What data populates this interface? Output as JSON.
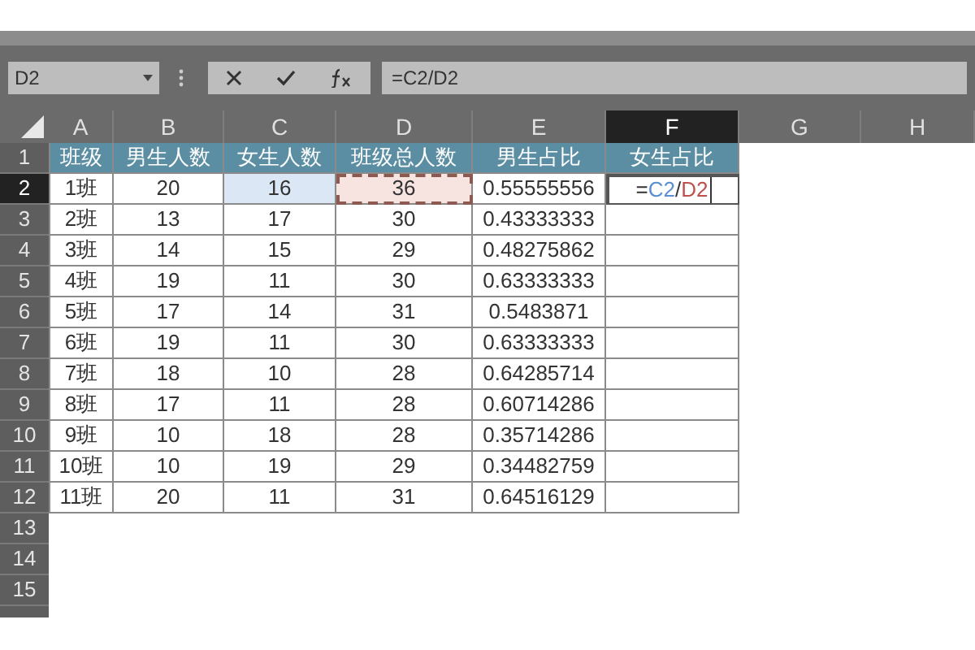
{
  "formula_bar": {
    "name_box": "D2",
    "formula": "=C2/D2"
  },
  "columns": [
    {
      "label": "A",
      "selected": false
    },
    {
      "label": "B",
      "selected": false
    },
    {
      "label": "C",
      "selected": false
    },
    {
      "label": "D",
      "selected": false
    },
    {
      "label": "E",
      "selected": false
    },
    {
      "label": "F",
      "selected": true
    },
    {
      "label": "G",
      "selected": false
    },
    {
      "label": "H",
      "selected": false
    }
  ],
  "rows": [
    {
      "number": "1",
      "selected": false,
      "kind": "header",
      "cells": [
        {
          "text": "班级"
        },
        {
          "text": "男生人数"
        },
        {
          "text": "女生人数"
        },
        {
          "text": "班级总人数"
        },
        {
          "text": "男生占比"
        },
        {
          "text": "女生占比"
        }
      ]
    },
    {
      "number": "2",
      "selected": true,
      "kind": "data",
      "cells": [
        {
          "text": "1班"
        },
        {
          "text": "20"
        },
        {
          "text": "16",
          "kind": "ref_solid"
        },
        {
          "text": "36",
          "kind": "ref_dashed"
        },
        {
          "text": "0.55555556"
        },
        {
          "kind": "editing",
          "segments": [
            {
              "text": "="
            },
            {
              "text": "C2",
              "color": "#5b8fd0"
            },
            {
              "text": "/"
            },
            {
              "text": "D2",
              "color": "#c0504d"
            }
          ]
        }
      ]
    },
    {
      "number": "3",
      "selected": false,
      "kind": "data",
      "cells": [
        {
          "text": "2班"
        },
        {
          "text": "13"
        },
        {
          "text": "17"
        },
        {
          "text": "30"
        },
        {
          "text": "0.43333333"
        },
        {
          "text": ""
        }
      ]
    },
    {
      "number": "4",
      "selected": false,
      "kind": "data",
      "cells": [
        {
          "text": "3班"
        },
        {
          "text": "14"
        },
        {
          "text": "15"
        },
        {
          "text": "29"
        },
        {
          "text": "0.48275862"
        },
        {
          "text": ""
        }
      ]
    },
    {
      "number": "5",
      "selected": false,
      "kind": "data",
      "cells": [
        {
          "text": "4班"
        },
        {
          "text": "19"
        },
        {
          "text": "11"
        },
        {
          "text": "30"
        },
        {
          "text": "0.63333333"
        },
        {
          "text": ""
        }
      ]
    },
    {
      "number": "6",
      "selected": false,
      "kind": "data",
      "cells": [
        {
          "text": "5班"
        },
        {
          "text": "17"
        },
        {
          "text": "14"
        },
        {
          "text": "31"
        },
        {
          "text": "0.5483871"
        },
        {
          "text": ""
        }
      ]
    },
    {
      "number": "7",
      "selected": false,
      "kind": "data",
      "cells": [
        {
          "text": "6班"
        },
        {
          "text": "19"
        },
        {
          "text": "11"
        },
        {
          "text": "30"
        },
        {
          "text": "0.63333333"
        },
        {
          "text": ""
        }
      ]
    },
    {
      "number": "8",
      "selected": false,
      "kind": "data",
      "cells": [
        {
          "text": "7班"
        },
        {
          "text": "18"
        },
        {
          "text": "10"
        },
        {
          "text": "28"
        },
        {
          "text": "0.64285714"
        },
        {
          "text": ""
        }
      ]
    },
    {
      "number": "9",
      "selected": false,
      "kind": "data",
      "cells": [
        {
          "text": "8班"
        },
        {
          "text": "17"
        },
        {
          "text": "11"
        },
        {
          "text": "28"
        },
        {
          "text": "0.60714286"
        },
        {
          "text": ""
        }
      ]
    },
    {
      "number": "10",
      "selected": false,
      "kind": "data",
      "cells": [
        {
          "text": "9班"
        },
        {
          "text": "10"
        },
        {
          "text": "18"
        },
        {
          "text": "28"
        },
        {
          "text": "0.35714286"
        },
        {
          "text": ""
        }
      ]
    },
    {
      "number": "11",
      "selected": false,
      "kind": "data",
      "cells": [
        {
          "text": "10班"
        },
        {
          "text": "10"
        },
        {
          "text": "19"
        },
        {
          "text": "29"
        },
        {
          "text": "0.34482759"
        },
        {
          "text": ""
        }
      ]
    },
    {
      "number": "12",
      "selected": false,
      "kind": "data",
      "cells": [
        {
          "text": "11班"
        },
        {
          "text": "20"
        },
        {
          "text": "11"
        },
        {
          "text": "31"
        },
        {
          "text": "0.64516129"
        },
        {
          "text": ""
        }
      ]
    },
    {
      "number": "13",
      "selected": false,
      "kind": "empty",
      "cells": []
    },
    {
      "number": "14",
      "selected": false,
      "kind": "empty",
      "cells": []
    },
    {
      "number": "15",
      "selected": false,
      "kind": "empty",
      "cells": []
    }
  ]
}
